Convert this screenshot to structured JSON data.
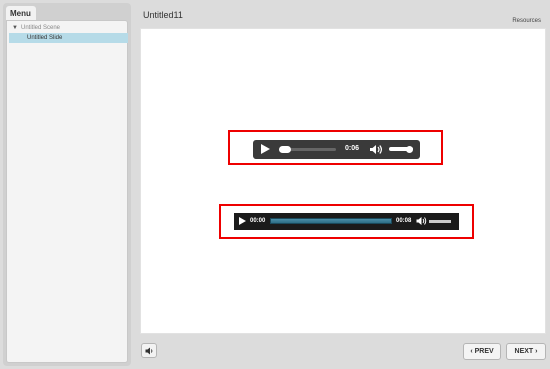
{
  "sidebar": {
    "tab_label": "Menu",
    "scene_label": "Untitled Scene",
    "slide_label": "Untitled Slide"
  },
  "main": {
    "title": "Untitled11",
    "resources_label": "Resources"
  },
  "player1": {
    "time": "0:06"
  },
  "player2": {
    "current_time": "00:00",
    "duration": "00:08"
  },
  "footer": {
    "prev_label": "PREV",
    "next_label": "NEXT"
  },
  "colors": {
    "highlight": "#ee0000",
    "selected_row": "#b6dbe8"
  }
}
